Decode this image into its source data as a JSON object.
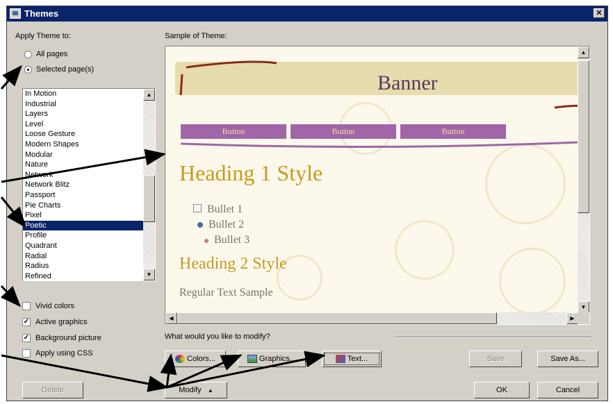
{
  "window": {
    "title": "Themes",
    "close_label": "✕"
  },
  "apply": {
    "label": "Apply Theme to:",
    "options": [
      {
        "label": "All pages",
        "selected": false
      },
      {
        "label": "Selected page(s)",
        "selected": true
      }
    ]
  },
  "themes": {
    "items": [
      "In Motion",
      "Industrial",
      "Layers",
      "Level",
      "Loose Gesture",
      "Modern Shapes",
      "Modular",
      "Nature",
      "Network",
      "Network Blitz",
      "Passport",
      "Pie Charts",
      "Pixel",
      "Poetic",
      "Profile",
      "Quadrant",
      "Radial",
      "Radius",
      "Refined"
    ],
    "selected": "Poetic"
  },
  "options": {
    "vivid": {
      "label": "Vivid colors",
      "checked": false
    },
    "active": {
      "label": "Active graphics",
      "checked": true
    },
    "background": {
      "label": "Background picture",
      "checked": true
    },
    "css": {
      "label": "Apply using CSS",
      "checked": false
    }
  },
  "sample": {
    "label": "Sample of Theme:",
    "banner": "Banner",
    "buttons": [
      "Button",
      "Button",
      "Button"
    ],
    "heading1": "Heading 1 Style",
    "bullets": [
      "Bullet 1",
      "Bullet 2",
      "Bullet 3"
    ],
    "heading2": "Heading 2 Style",
    "regular": "Regular Text Sample"
  },
  "modify": {
    "question": "What would you like to modify?",
    "colors": "Colors...",
    "graphics": "Graphics...",
    "text": "Text...",
    "save": "Save",
    "save_as": "Save As..."
  },
  "footer": {
    "delete": "Delete",
    "modify": "Modify",
    "modify_arrow": "▲",
    "ok": "OK",
    "cancel": "Cancel"
  },
  "colors": {
    "titlebar": "#0a246a",
    "selection": "#0a246a",
    "accent_button": "#a066a8",
    "heading": "#c79a1c",
    "banner_text": "#5a3560"
  }
}
